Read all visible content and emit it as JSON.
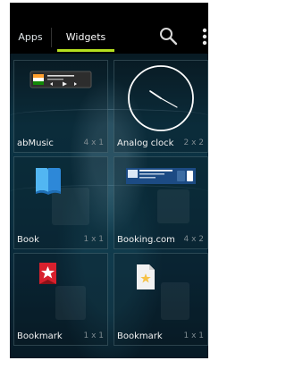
{
  "tabs": [
    {
      "label": "Apps",
      "selected": false
    },
    {
      "label": "Widgets",
      "selected": true
    }
  ],
  "toolbar": {
    "search_icon": "search-icon",
    "menu_icon": "menu-icon"
  },
  "widgets": [
    {
      "name": "abMusic",
      "size": "4 x 1"
    },
    {
      "name": "Analog clock",
      "size": "2 x 2"
    },
    {
      "name": "Book",
      "size": "1 x 1"
    },
    {
      "name": "Booking.com",
      "size": "4 x 2"
    },
    {
      "name": "Bookmark",
      "size": "1 x 1"
    },
    {
      "name": "Bookmark",
      "size": "1 x 1"
    }
  ],
  "colors": {
    "accent_tab": "#b5df1f",
    "widget_name": "#f2f2f2",
    "widget_size": "#7f8b91",
    "background_top": "#081a23",
    "background_mid": "#0c3445"
  }
}
